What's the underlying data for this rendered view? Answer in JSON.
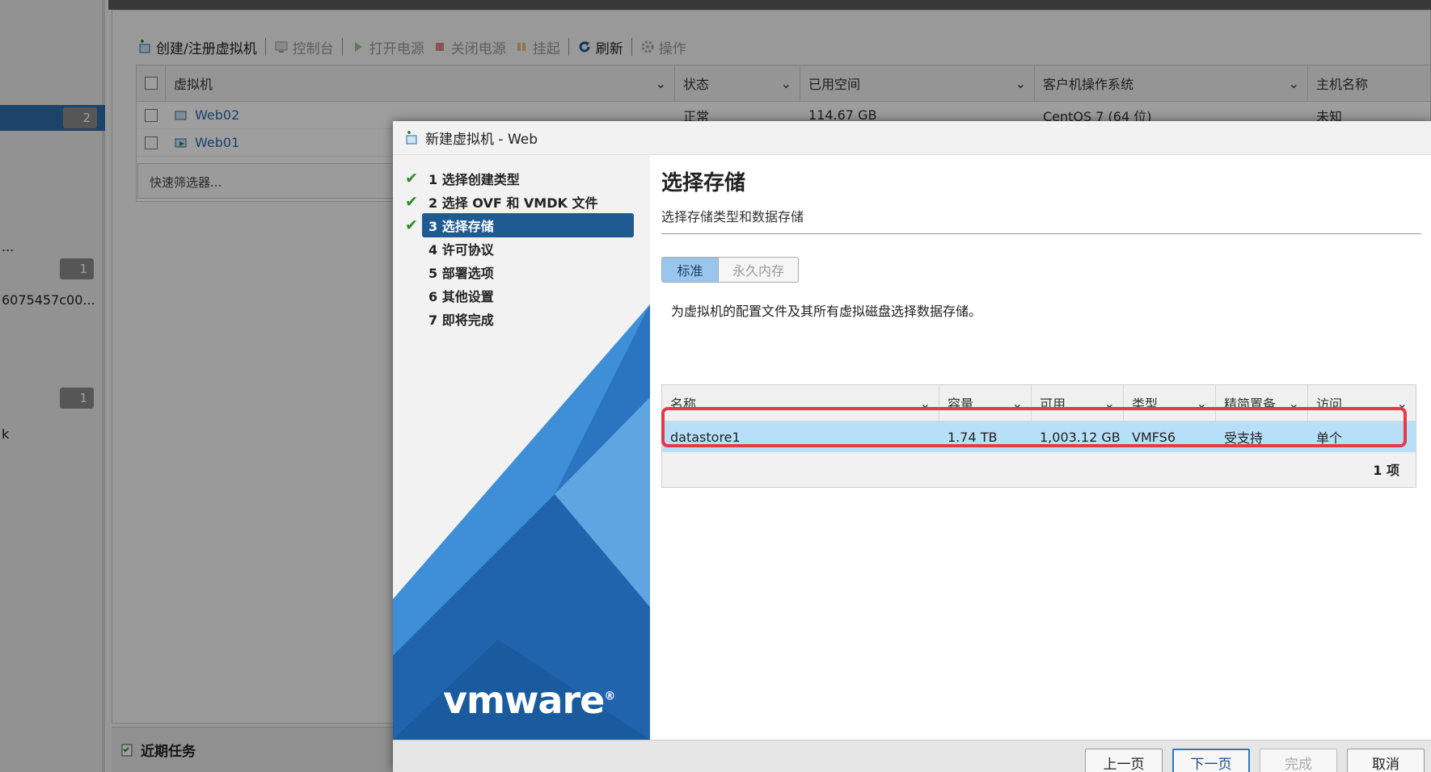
{
  "toolbar": {
    "create_register": "创建/注册虚拟机",
    "console": "控制台",
    "power_on": "打开电源",
    "power_off": "关闭电源",
    "suspend": "挂起",
    "refresh": "刷新",
    "actions": "操作"
  },
  "left_pane": {
    "badge_top": "2",
    "badge_mid": "1",
    "badge_low": "1",
    "fragment_id": "6075457c00...",
    "fragment_dots": "...",
    "fragment_k": "k"
  },
  "vm_grid": {
    "columns": [
      "虚拟机",
      "状态",
      "已用空间",
      "客户机操作系统",
      "主机名称"
    ],
    "rows": [
      {
        "name": "Web02",
        "status": "正常",
        "used": "114.67 GB",
        "os": "CentOS 7 (64 位)",
        "host": "未知"
      },
      {
        "name": "Web01",
        "status": "",
        "used": "",
        "os": "",
        "host": ""
      }
    ],
    "quick_filter": "快速筛选器..."
  },
  "recent_tasks": "近期任务",
  "dialog": {
    "title": "新建虚拟机 - Web",
    "steps": [
      {
        "label": "1 选择创建类型",
        "done": true
      },
      {
        "label": "2 选择 OVF 和 VMDK 文件",
        "done": true
      },
      {
        "label": "3 选择存储",
        "done": true,
        "active": true
      },
      {
        "label": "4 许可协议",
        "done": false
      },
      {
        "label": "5 部署选项",
        "done": false
      },
      {
        "label": "6 其他设置",
        "done": false
      },
      {
        "label": "7 即将完成",
        "done": false
      }
    ],
    "logo_text": "vmware",
    "page_title": "选择存储",
    "page_subtitle": "选择存储类型和数据存储",
    "seg_standard": "标准",
    "seg_persistent": "永久内存",
    "description": "为虚拟机的配置文件及其所有虚拟磁盘选择数据存储。",
    "table": {
      "columns": [
        "名称",
        "容量",
        "可用",
        "类型",
        "精简置备",
        "访问"
      ],
      "row": {
        "name": "datastore1",
        "capacity": "1.74 TB",
        "free": "1,003.12 GB",
        "type": "VMFS6",
        "thin": "受支持",
        "access": "单个"
      },
      "count": "1 项"
    },
    "buttons": {
      "back": "上一页",
      "next": "下一页",
      "finish": "完成",
      "cancel": "取消"
    }
  }
}
